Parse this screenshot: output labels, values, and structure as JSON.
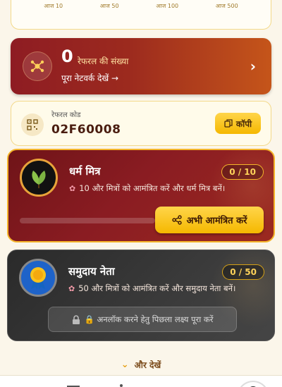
{
  "top_card": {
    "items": [
      "आज 10",
      "आज 50",
      "आज 100",
      "आज 500"
    ]
  },
  "referral": {
    "count": "0",
    "count_label": "रेफरल की संख्या",
    "network_link": "पूरा नेटवर्क देखें →"
  },
  "code": {
    "label": "रेफरल कोड",
    "value": "02F60008",
    "copy_label": "कॉपी"
  },
  "levels": [
    {
      "title": "धर्म मित्र",
      "description": "10 और मित्रों को आमंत्रित करें और धर्म मित्र बनें।",
      "progress_text": "0 / 10",
      "progress_fraction": 0,
      "invite_label": "अभी आमंत्रित करें"
    },
    {
      "title": "समुदाय नेता",
      "description": "50 और मित्रों को आमंत्रित करें और समुदाय नेता बनें।",
      "progress_text": "0 / 50",
      "locked_note": "🔒 अनलॉक करने हेतु पिछला लक्ष्य पूरा करें"
    }
  ],
  "see_more": "और देखें",
  "colors": {
    "accent_gold": "#f5b800",
    "maroon": "#8a1c22",
    "locked_gray": "#3b3b3b"
  }
}
